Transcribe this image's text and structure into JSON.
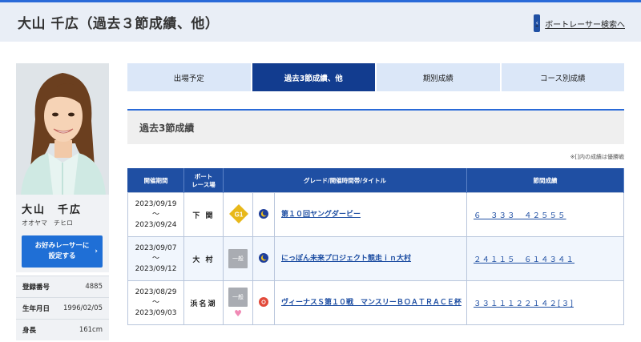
{
  "header": {
    "title": "大山 千広（過去３節成績、他）",
    "search_link": "ボートレーサー検索へ"
  },
  "profile": {
    "name": "大山　千広",
    "kana": "オオヤマ　チヒロ",
    "fav_button": "お好みレーサーに\n設定する",
    "stats": [
      {
        "label": "登録番号",
        "value": "4885"
      },
      {
        "label": "生年月日",
        "value": "1996/02/05"
      },
      {
        "label": "身長",
        "value": "161cm"
      }
    ]
  },
  "tabs": [
    {
      "label": "出場予定",
      "active": false
    },
    {
      "label": "過去3節成績、他",
      "active": true
    },
    {
      "label": "期別成績",
      "active": false
    },
    {
      "label": "コース別成績",
      "active": false
    }
  ],
  "section": {
    "title": "過去3節成績",
    "note": "※[]内の成績は優勝戦"
  },
  "table": {
    "headers": [
      "開催期間",
      "ボート\nレース場",
      "グレード/開催時間帯/タイトル",
      "節間成績"
    ],
    "rows": [
      {
        "date_start": "2023/09/19",
        "tilde": "～",
        "date_end": "2023/09/24",
        "venue": "下 関",
        "grade": "G1",
        "time_icon": "moon-icon",
        "title": "第１０回ヤングダービー",
        "result": "６　３３３　４２５５５",
        "heart": false
      },
      {
        "date_start": "2023/09/07",
        "tilde": "～",
        "date_end": "2023/09/12",
        "venue": "大 村",
        "grade": "一般",
        "time_icon": "moon-icon",
        "title": "にっぽん未来プロジェクト競走ｉｎ大村",
        "result": "２４１１５　６１４３４１",
        "heart": false
      },
      {
        "date_start": "2023/08/29",
        "tilde": "～",
        "date_end": "2023/09/03",
        "venue": "浜名湖",
        "grade": "一般",
        "time_icon": "sun-icon",
        "title": "ヴィーナスＳ第１０戦　マンスリーＢＯＡＴＲＡＣＥ杯",
        "result": "３３１１１２２１４２[３]",
        "heart": true
      }
    ]
  },
  "colors": {
    "accent": "#1f4fa3",
    "tab_active": "#123c8f",
    "tab_inactive": "#dbe7f8",
    "button": "#1f6fd6",
    "g1": "#e8b81a",
    "ippan": "#a9acb2",
    "heart": "#f08ab5"
  }
}
